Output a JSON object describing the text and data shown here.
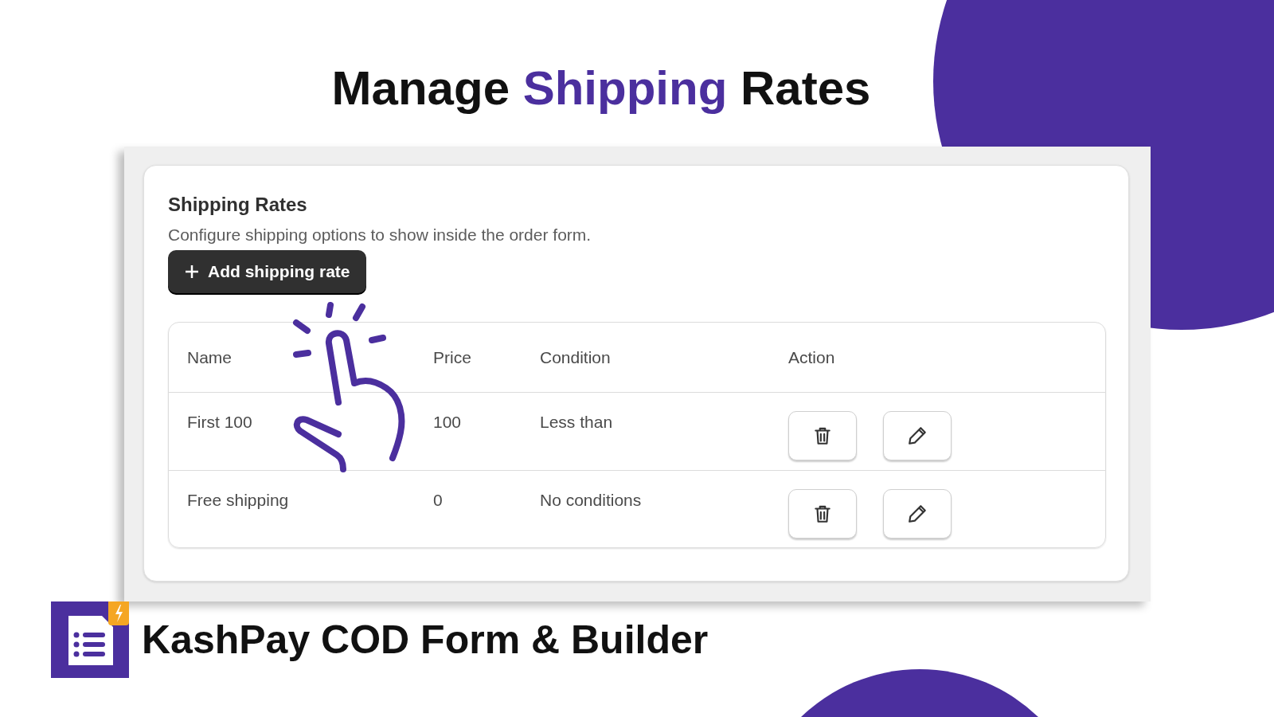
{
  "headline": [
    {
      "kind": "plain",
      "text": "Manage"
    },
    {
      "kind": "accent",
      "text": "Shipping"
    },
    {
      "kind": "plain",
      "text": "Rates"
    }
  ],
  "card": {
    "title": "Shipping Rates",
    "description": "Configure shipping options to show inside the order form.",
    "add_button": {
      "label": "Add shipping rate"
    },
    "table": {
      "columns": [
        "Name",
        "Price",
        "Condition",
        "Action"
      ],
      "rows": [
        {
          "name": "First 100",
          "price": "100",
          "condition": "Less than"
        },
        {
          "name": "Free shipping",
          "price": "0",
          "condition": "No conditions"
        }
      ]
    }
  },
  "brand": {
    "name": "KashPay COD Form & Builder"
  }
}
